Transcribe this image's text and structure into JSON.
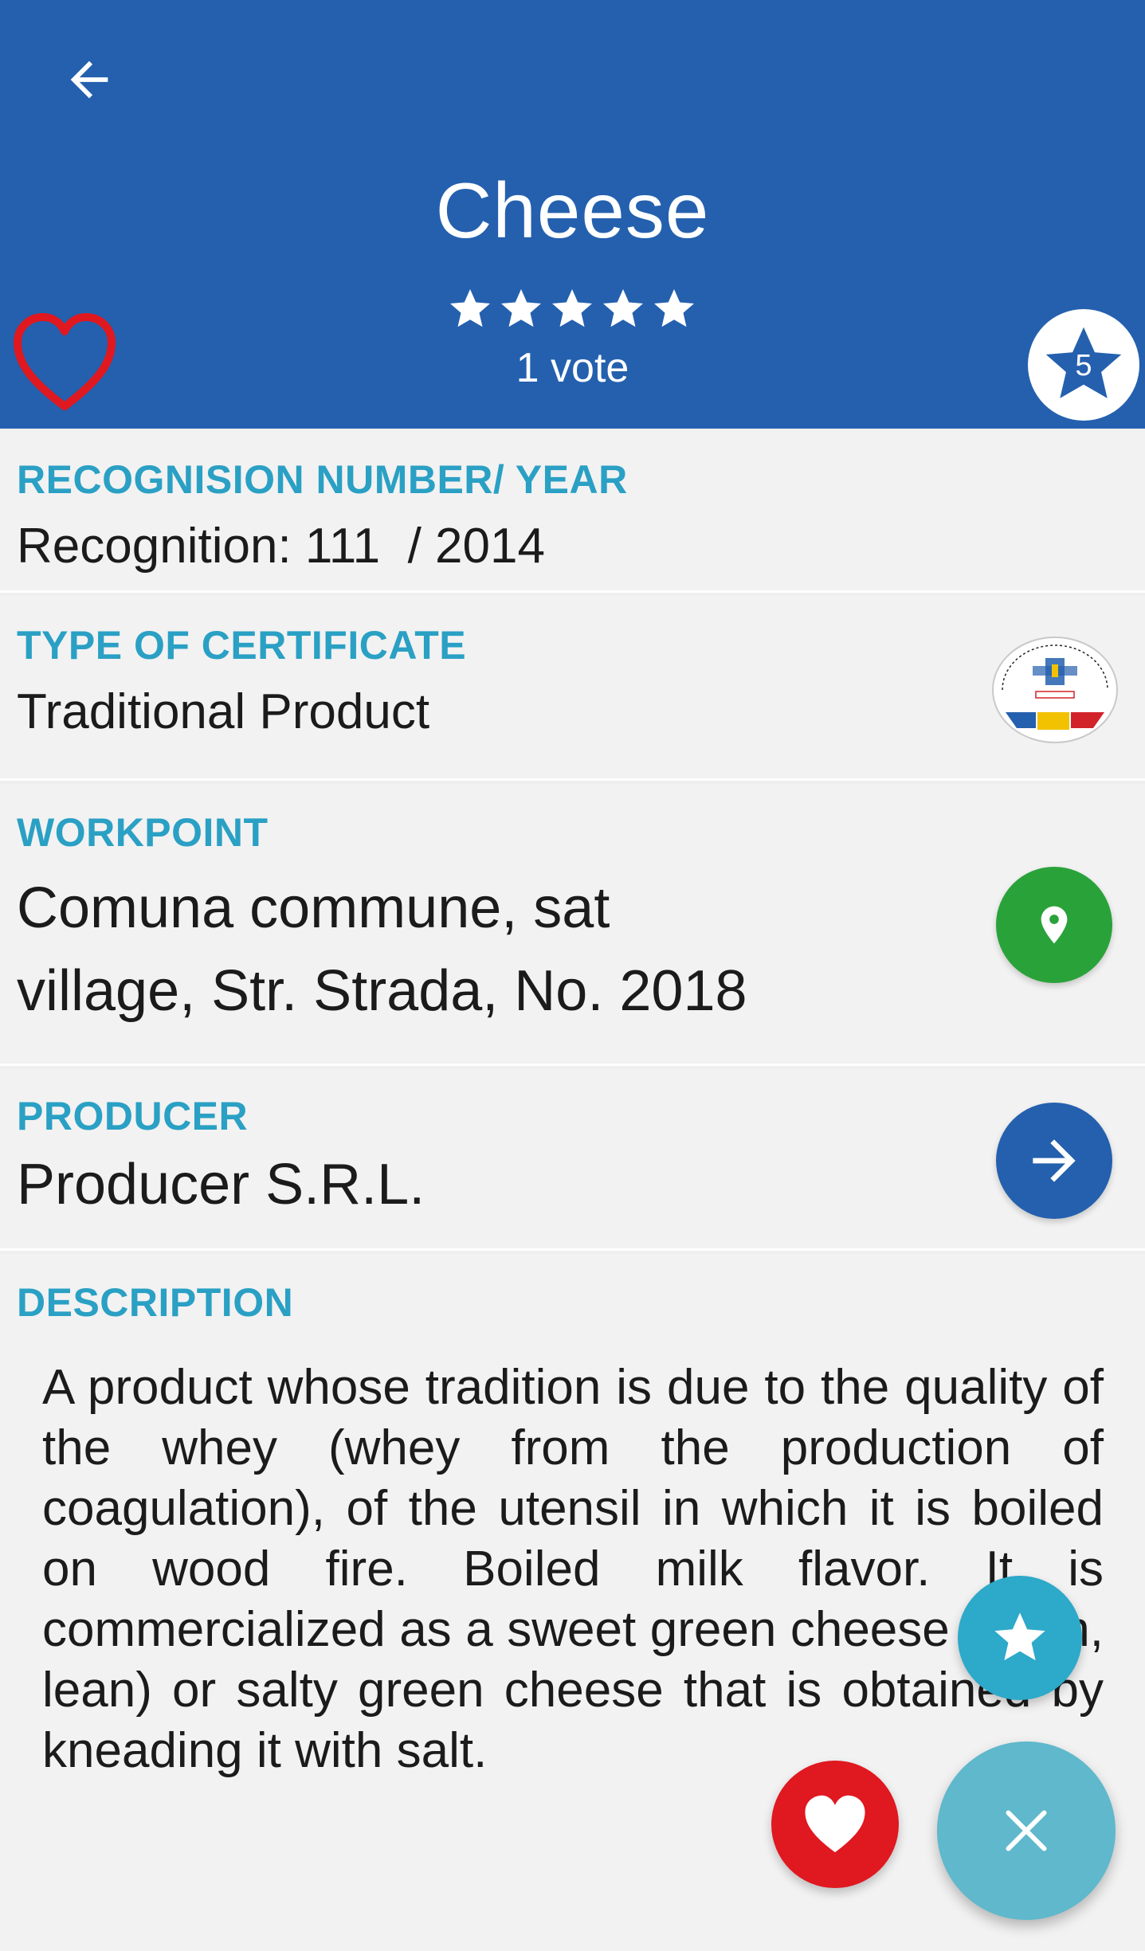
{
  "header": {
    "title": "Cheese",
    "rating_stars": 5,
    "votes_text": "1 vote",
    "rate_badge_number": "5",
    "back_icon": "arrow-left-icon",
    "favorite_icon": "heart-outline-icon",
    "badge_icon": "star-icon",
    "background_color": "#2460ae"
  },
  "recognition": {
    "label": "RECOGNISION NUMBER/ YEAR",
    "value": "Recognition: 111  / 2014"
  },
  "certificate": {
    "label": "TYPE OF CERTIFICATE",
    "value": "Traditional Product",
    "logo_icon": "produs-traditional-seal"
  },
  "workpoint": {
    "label": "WORKPOINT",
    "line1": "Comuna commune, sat",
    "line2": "village, Str. Strada, No. 2018",
    "action_icon": "map-pin-icon"
  },
  "producer": {
    "label": "PRODUCER",
    "value": "Producer S.R.L.",
    "action_icon": "arrow-right-icon"
  },
  "description": {
    "label": "DESCRIPTION",
    "text": "A product whose tradition is due to the quality of the whey (whey from the production of coagulation), of the utensil in which it is boiled on wood fire. Boiled milk flavor. It is commercialized as a sweet green cheese (fresh, lean) or salty green cheese that is obtained by kneading it with salt."
  },
  "fabs": {
    "rate_icon": "star-icon",
    "favorite_icon": "heart-icon",
    "close_icon": "close-icon"
  },
  "colors": {
    "accent_label": "#2aa0c4",
    "map_button": "#2aa23a",
    "favorite_red": "#e0181f",
    "fab_close": "#5fb8cc"
  }
}
